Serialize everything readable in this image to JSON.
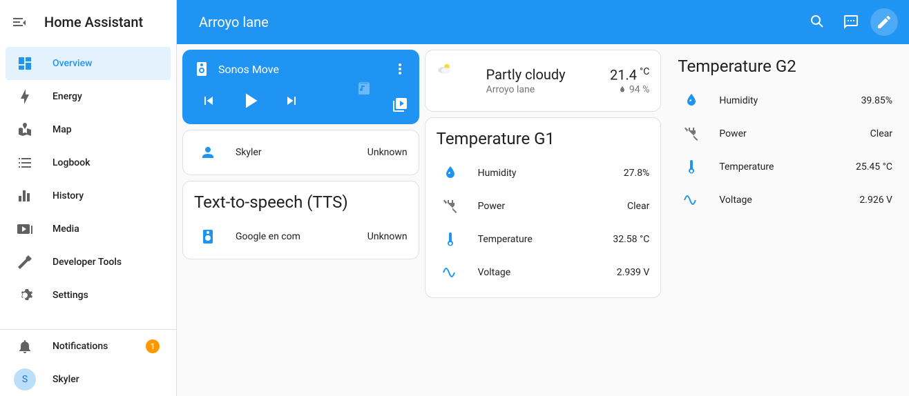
{
  "app_title": "Home Assistant",
  "topbar": {
    "title": "Arroyo lane"
  },
  "sidebar": {
    "items": [
      {
        "label": "Overview",
        "icon": "dashboard-icon",
        "active": true
      },
      {
        "label": "Energy",
        "icon": "lightning-icon",
        "active": false
      },
      {
        "label": "Map",
        "icon": "map-icon",
        "active": false
      },
      {
        "label": "Logbook",
        "icon": "logbook-icon",
        "active": false
      },
      {
        "label": "History",
        "icon": "history-icon",
        "active": false
      },
      {
        "label": "Media",
        "icon": "media-icon",
        "active": false
      },
      {
        "label": "Developer Tools",
        "icon": "hammer-icon",
        "active": false
      },
      {
        "label": "Settings",
        "icon": "gear-icon",
        "active": false
      }
    ],
    "notifications": {
      "label": "Notifications",
      "count": "1"
    },
    "user": {
      "label": "Skyler",
      "initial": "S"
    }
  },
  "media_card": {
    "title": "Sonos Move"
  },
  "person_card": {
    "name": "Skyler",
    "state": "Unknown"
  },
  "tts_card": {
    "title": "Text-to-speech (TTS)",
    "item_name": "Google en com",
    "item_state": "Unknown"
  },
  "weather_card": {
    "condition": "Partly cloudy",
    "location": "Arroyo lane",
    "temperature": "21.4",
    "temperature_unit": "°C",
    "humidity": "94 %"
  },
  "g1_card": {
    "title": "Temperature G1",
    "rows": [
      {
        "name": "Humidity",
        "value": "27.8%"
      },
      {
        "name": "Power",
        "value": "Clear"
      },
      {
        "name": "Temperature",
        "value": "32.58 °C"
      },
      {
        "name": "Voltage",
        "value": "2.939 V"
      }
    ]
  },
  "g2_card": {
    "title": "Temperature G2",
    "rows": [
      {
        "name": "Humidity",
        "value": "39.85%"
      },
      {
        "name": "Power",
        "value": "Clear"
      },
      {
        "name": "Temperature",
        "value": "25.45 °C"
      },
      {
        "name": "Voltage",
        "value": "2.926 V"
      }
    ]
  }
}
